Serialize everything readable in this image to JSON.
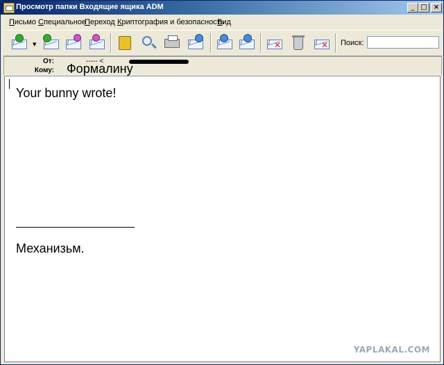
{
  "window": {
    "title": "Просмотр папки Входящие ящика ADM",
    "minimize": "_",
    "maximize": "□",
    "close": "×"
  },
  "menu": {
    "items": [
      {
        "label": "Письмо",
        "key": "П",
        "rest": "исьмо"
      },
      {
        "label": "Специальное",
        "key": "С",
        "rest": "пециальное"
      },
      {
        "label": "Переход",
        "key": "П",
        "rest": "ереход"
      },
      {
        "label": "Криптография и безопасность",
        "key": "К",
        "rest": "риптография и безопасность"
      },
      {
        "label": "Вид",
        "key": "В",
        "rest": "ид"
      }
    ]
  },
  "toolbar": {
    "search_label": "Поиск:",
    "search_value": "",
    "icons": [
      "receive-mail-icon",
      "reply-all-icon",
      "reply-icon",
      "forward-icon",
      "address-book-icon",
      "find-icon",
      "print-icon",
      "save-icon",
      "previous-message-icon",
      "next-message-icon",
      "mark-junk-icon",
      "delete-icon",
      "block-sender-icon"
    ]
  },
  "headers": {
    "from_label": "От:",
    "from_value": "----- <",
    "to_label": "Кому:",
    "to_value": "Формалину"
  },
  "message": {
    "line1": "Your bunny wrote!",
    "line2": "Механизьм."
  },
  "watermark": "YAPLAKAL.COM",
  "colors": {
    "titlebar_start": "#0a246a",
    "titlebar_end": "#a6caf0",
    "chrome": "#ece9d8"
  }
}
